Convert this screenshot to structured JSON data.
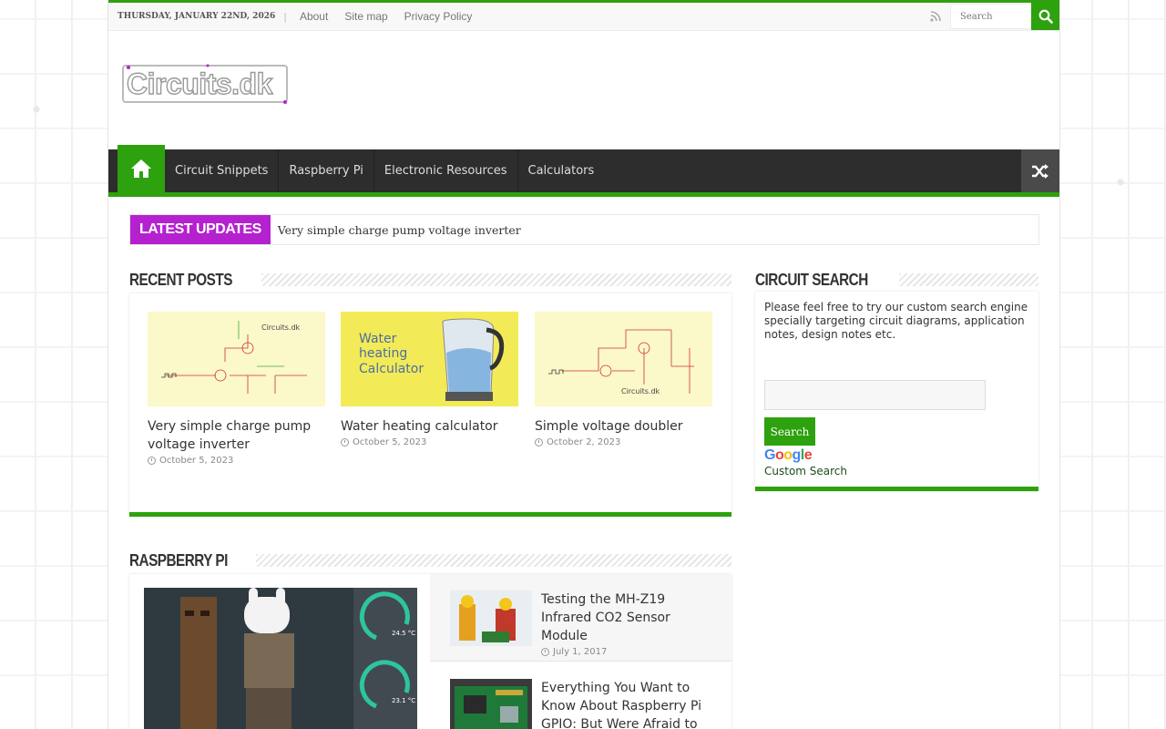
{
  "topbar": {
    "date": "Thursday, January 22nd, 2026",
    "links": [
      "About",
      "Site map",
      "Privacy Policy"
    ],
    "search_placeholder": "Search"
  },
  "nav": {
    "items": [
      "Circuit Snippets",
      "Raspberry Pi",
      "Electronic Resources",
      "Calculators"
    ]
  },
  "ticker": {
    "label": "Latest Updates",
    "text": "Very simple charge pump voltage inverter"
  },
  "recent": {
    "title": "Recent Posts",
    "posts": [
      {
        "title": "Very simple charge pump voltage inverter",
        "date": "October 5, 2023"
      },
      {
        "title": "Water heating calculator",
        "date": "October 5, 2023",
        "thumb_text": "Water heating Calculator"
      },
      {
        "title": "Simple voltage doubler",
        "date": "October 2, 2023"
      }
    ],
    "thumb_brand": "Circuits.dk"
  },
  "sidebar": {
    "title": "Circuit Search",
    "description": "Please feel free to try our custom search engine specially targeting circuit diagrams, application notes, design notes etc.",
    "button": "Search",
    "google_label": "Custom Search"
  },
  "rpi": {
    "title": "Raspberry Pi",
    "items": [
      {
        "title": "Testing the MH-Z19 Infrared CO2 Sensor Module",
        "date": "July 1, 2017"
      },
      {
        "title": "Everything You Want to Know About Raspberry Pi GPIO: But Were Afraid to Ask"
      }
    ]
  },
  "colors": {
    "accent": "#2ea10e",
    "ticker": "#b421cf",
    "nav": "#2d2d2d"
  }
}
